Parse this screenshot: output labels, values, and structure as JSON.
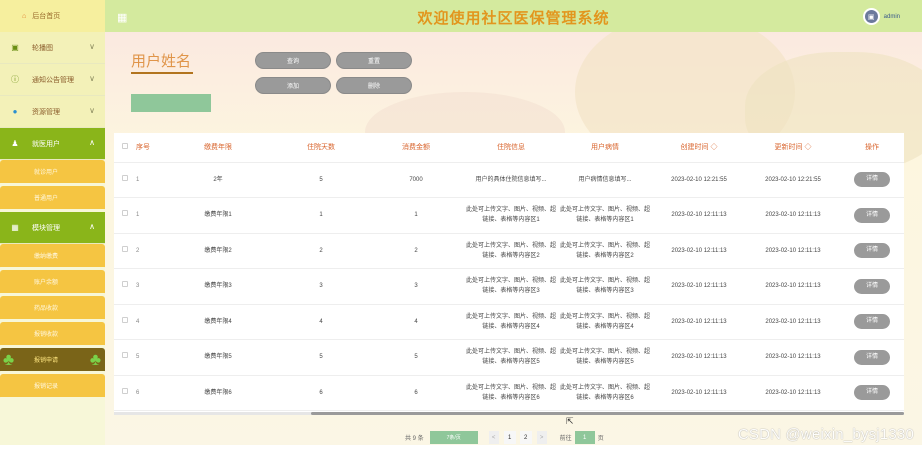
{
  "sidebar": {
    "home": "后台首页",
    "menus": [
      {
        "label": "轮播图",
        "icon": "image-icon",
        "chevron": "∨"
      },
      {
        "label": "通知公告管理",
        "icon": "notice-icon",
        "chevron": "∨"
      },
      {
        "label": "资源管理",
        "icon": "resource-icon",
        "chevron": "∨"
      }
    ],
    "group1": {
      "label": "就医用户",
      "chevron": "∧",
      "subs": [
        "就诊用户",
        "普通用户"
      ]
    },
    "group2": {
      "label": "模块管理",
      "chevron": "∧",
      "subs": [
        "缴纳缴费",
        "账户余额",
        "药品收款",
        "报销收款",
        "报销申请",
        "报销记录"
      ]
    }
  },
  "header": {
    "title": "欢迎使用社区医保管理系统",
    "user": "admin"
  },
  "search": {
    "label": "用户姓名",
    "buttons": [
      "查询",
      "重置",
      "添加",
      "删除"
    ]
  },
  "table": {
    "columns": [
      "序号",
      "缴费年限",
      "住院天数",
      "消费金额",
      "住院信息",
      "用户病情",
      "创建时间 ◇",
      "更新时间 ◇",
      "操作"
    ],
    "rows": [
      [
        "1",
        "2年",
        "5",
        "7000",
        "用户的具体住院信息填写...",
        "用户病情信息填写...",
        "2023-02-10 12:21:55",
        "2023-02-10 12:21:55",
        "详情"
      ],
      [
        "1",
        "缴费年限1",
        "1",
        "1",
        "此处可上传文字、图片、视频、超链接、表格等内容区1",
        "此处可上传文字、图片、视频、超链接、表格等内容区1",
        "2023-02-10 12:11:13",
        "2023-02-10 12:11:13",
        "详情"
      ],
      [
        "2",
        "缴费年限2",
        "2",
        "2",
        "此处可上传文字、图片、视频、超链接、表格等内容区2",
        "此处可上传文字、图片、视频、超链接、表格等内容区2",
        "2023-02-10 12:11:13",
        "2023-02-10 12:11:13",
        "详情"
      ],
      [
        "3",
        "缴费年限3",
        "3",
        "3",
        "此处可上传文字、图片、视频、超链接、表格等内容区3",
        "此处可上传文字、图片、视频、超链接、表格等内容区3",
        "2023-02-10 12:11:13",
        "2023-02-10 12:11:13",
        "详情"
      ],
      [
        "4",
        "缴费年限4",
        "4",
        "4",
        "此处可上传文字、图片、视频、超链接、表格等内容区4",
        "此处可上传文字、图片、视频、超链接、表格等内容区4",
        "2023-02-10 12:11:13",
        "2023-02-10 12:11:13",
        "详情"
      ],
      [
        "5",
        "缴费年限5",
        "5",
        "5",
        "此处可上传文字、图片、视频、超链接、表格等内容区5",
        "此处可上传文字、图片、视频、超链接、表格等内容区5",
        "2023-02-10 12:11:13",
        "2023-02-10 12:11:13",
        "详情"
      ],
      [
        "6",
        "缴费年限6",
        "6",
        "6",
        "此处可上传文字、图片、视频、超链接、表格等内容区6",
        "此处可上传文字、图片、视频、超链接、表格等内容区6",
        "2023-02-10 12:11:13",
        "2023-02-10 12:11:13",
        "详情"
      ]
    ]
  },
  "pager": {
    "total": "共 9 条",
    "size": "7条/页",
    "prev": "<",
    "pages": [
      "1",
      "2"
    ],
    "next": ">",
    "goto": "前往",
    "page_input": "1",
    "page_unit": "页"
  },
  "watermark": "CSDN @weixin_bysj1330"
}
